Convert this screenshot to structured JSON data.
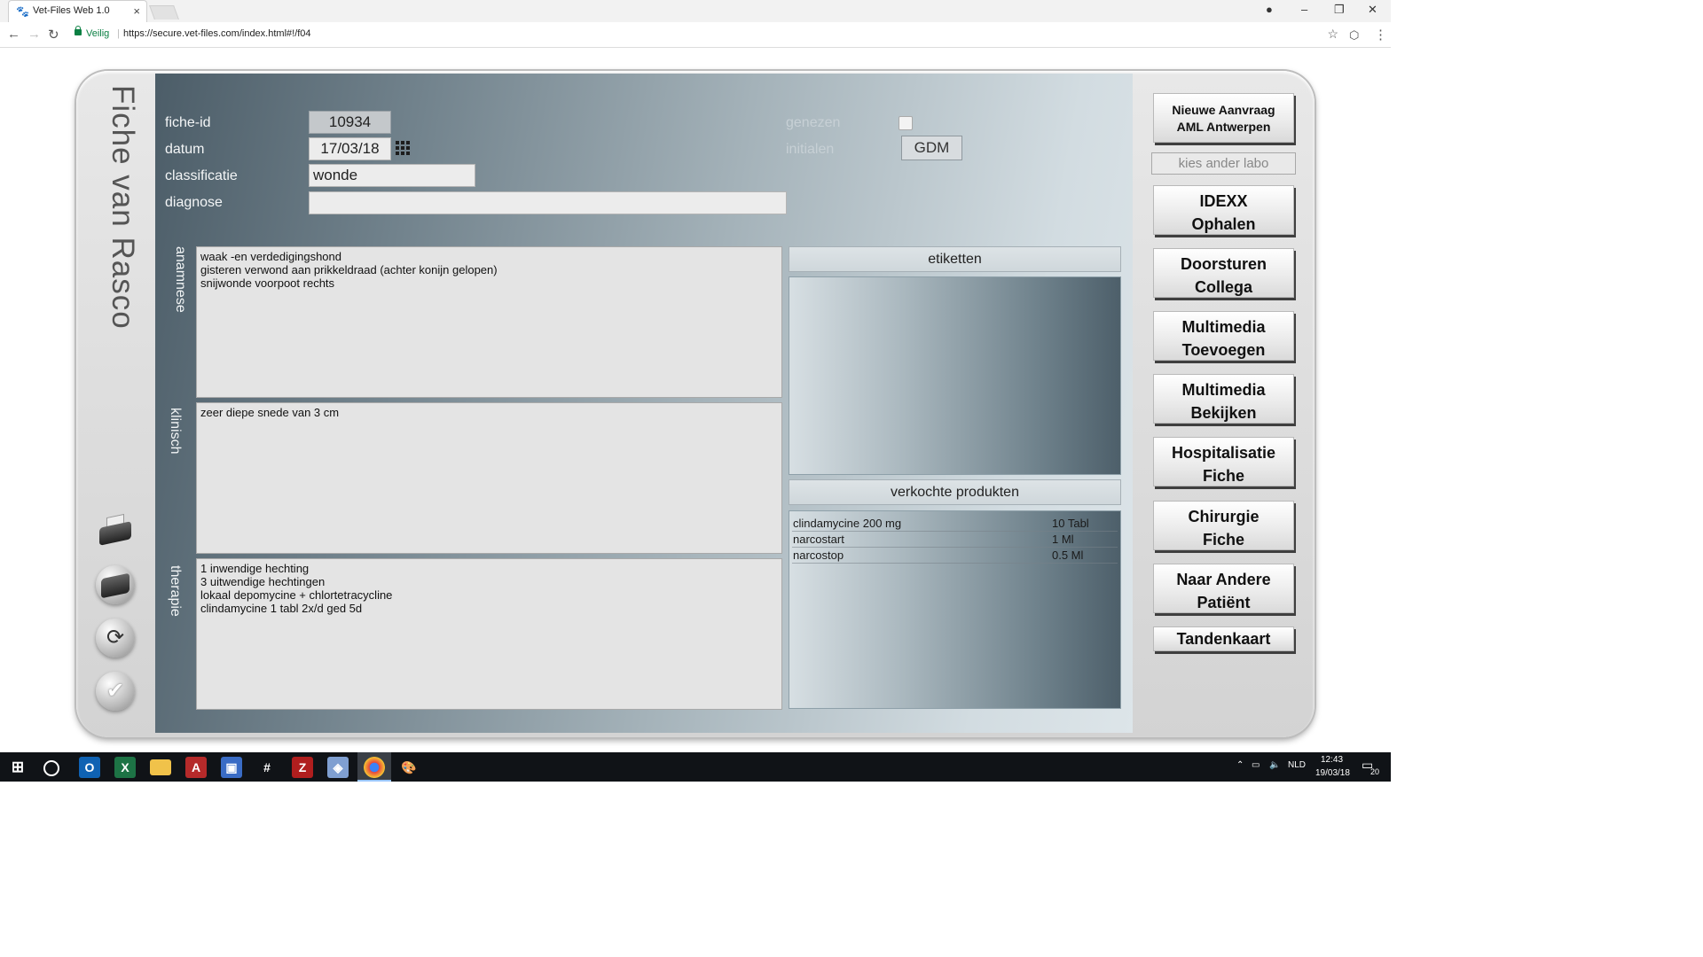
{
  "browser": {
    "tab_title": "Vet-Files Web 1.0",
    "tab_close": "×",
    "security_label": "Veilig",
    "url": "https://secure.vet-files.com/index.html#!/f04",
    "win_min": "–",
    "win_max": "❐",
    "win_close": "✕"
  },
  "app": {
    "title": "Fiche van Rasco"
  },
  "form": {
    "fiche_id_label": "fiche-id",
    "fiche_id_value": "10934",
    "datum_label": "datum",
    "datum_value": "17/03/18",
    "classificatie_label": "classificatie",
    "classificatie_value": "wonde",
    "diagnose_label": "diagnose",
    "diagnose_value": "",
    "genezen_label": "genezen",
    "genezen_checked": false,
    "initialen_label": "initialen",
    "initialen_value": "GDM"
  },
  "sections": {
    "anamnese_label": "anamnese",
    "anamnese_lines": [
      "waak -en verdedigingshond",
      "gisteren verwond aan prikkeldraad (achter konijn gelopen)",
      "snijwonde voorpoot rechts"
    ],
    "klinisch_label": "klinisch",
    "klinisch_lines": [
      "zeer diepe snede van 3 cm"
    ],
    "therapie_label": "therapie",
    "therapie_lines": [
      "1 inwendige hechting",
      "3 uitwendige hechtingen",
      "lokaal depomycine + chlortetracycline",
      "clindamycine 1 tabl 2x/d ged 5d"
    ],
    "etiketten_label": "etiketten",
    "verkochte_label": "verkochte produkten",
    "products": [
      {
        "name": "clindamycine 200 mg",
        "qty": "10 Tabl"
      },
      {
        "name": "narcostart",
        "qty": "1 Ml"
      },
      {
        "name": "narcostop",
        "qty": "0.5 Ml"
      }
    ]
  },
  "buttons": {
    "aml_line1": "Nieuwe Aanvraag",
    "aml_line2": "AML Antwerpen",
    "labo_placeholder": "kies ander labo",
    "idexx_line1": "IDEXX",
    "idexx_line2": "Ophalen",
    "doorsturen_line1": "Doorsturen",
    "doorsturen_line2": "Collega",
    "mm_add_line1": "Multimedia",
    "mm_add_line2": "Toevoegen",
    "mm_view_line1": "Multimedia",
    "mm_view_line2": "Bekijken",
    "hosp_line1": "Hospitalisatie",
    "hosp_line2": "Fiche",
    "chir_line1": "Chirurgie",
    "chir_line2": "Fiche",
    "naar_line1": "Naar Andere",
    "naar_line2": "Patiënt",
    "tandenkaart": "Tandenkaart"
  },
  "taskbar": {
    "lang": "NLD",
    "time": "12:43",
    "date": "19/03/18",
    "notif_count": "20"
  },
  "icons": {
    "side": [
      "printer-icon",
      "label-printer-icon",
      "refresh-icon",
      "check-icon"
    ]
  }
}
